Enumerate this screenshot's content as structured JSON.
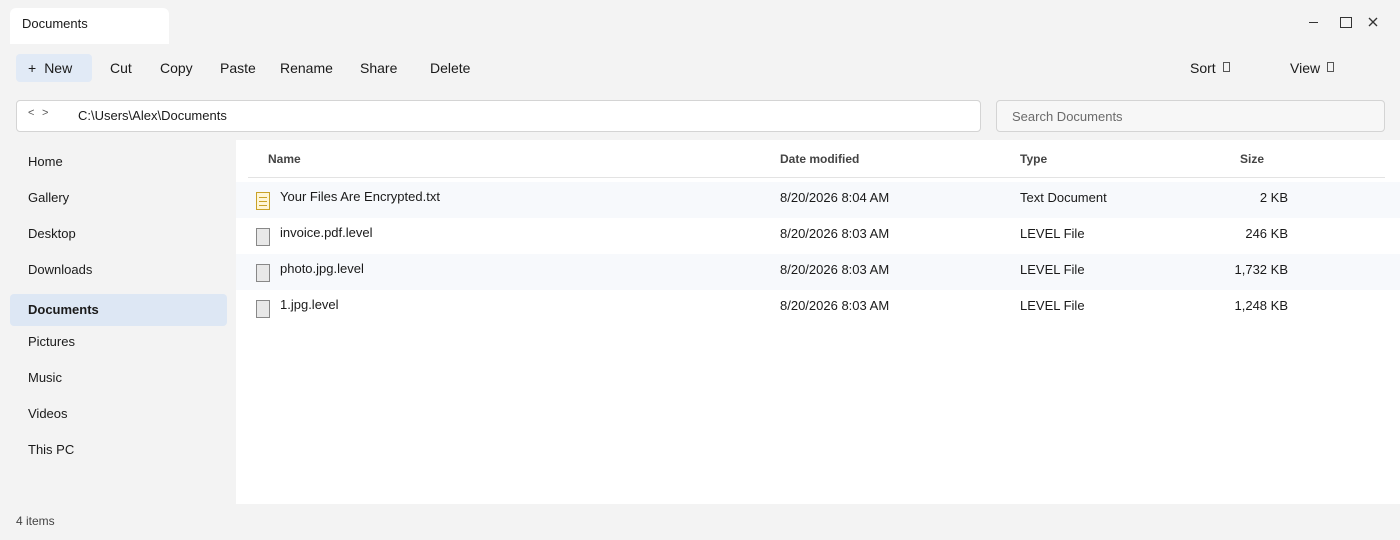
{
  "window": {
    "tab_title": "Documents"
  },
  "toolbar": {
    "new_label": "New",
    "cut_label": "Cut",
    "copy_label": "Copy",
    "paste_label": "Paste",
    "rename_label": "Rename",
    "share_label": "Share",
    "delete_label": "Delete",
    "sort_label": "Sort",
    "view_label": "View"
  },
  "address": {
    "path": "C:\\Users\\Alex\\Documents"
  },
  "search": {
    "placeholder": "Search Documents",
    "value": ""
  },
  "sidebar": {
    "items": [
      {
        "label": "Home",
        "active": false
      },
      {
        "label": "Gallery",
        "active": false
      },
      {
        "label": "Desktop",
        "active": false
      },
      {
        "label": "Downloads",
        "active": false
      },
      {
        "label": "Documents",
        "active": true
      },
      {
        "label": "Pictures",
        "active": false
      },
      {
        "label": "Music",
        "active": false
      },
      {
        "label": "Videos",
        "active": false
      },
      {
        "label": "This PC",
        "active": false
      }
    ]
  },
  "file_list": {
    "columns": {
      "name": "Name",
      "date": "Date modified",
      "type": "Type",
      "size": "Size"
    },
    "rows": [
      {
        "name": "Your Files Are Encrypted.txt",
        "date": "8/20/2026 8:04 AM",
        "type": "Text Document",
        "size": "2 KB",
        "icon": "text-file-icon"
      },
      {
        "name": "invoice.pdf.level",
        "date": "8/20/2026 8:03 AM",
        "type": "LEVEL File",
        "size": "246 KB",
        "icon": "file-icon"
      },
      {
        "name": "photo.jpg.level",
        "date": "8/20/2026 8:03 AM",
        "type": "LEVEL File",
        "size": "1,732 KB",
        "icon": "file-icon"
      },
      {
        "name": "1.jpg.level",
        "date": "8/20/2026 8:03 AM",
        "type": "LEVEL File",
        "size": "1,248 KB",
        "icon": "file-icon"
      }
    ]
  },
  "status": {
    "item_count": "4 items"
  },
  "colors": {
    "window_bg": "#f3f3f3",
    "active_nav_bg": "#dde7f4",
    "new_button_bg": "#e1eaf6",
    "text_icon_accent": "#c9a227"
  }
}
